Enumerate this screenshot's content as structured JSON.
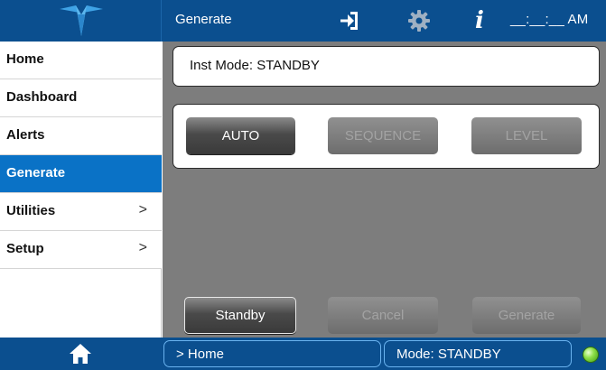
{
  "header": {
    "page_title": "Generate",
    "clock": "__:__:__ AM"
  },
  "sidebar": {
    "items": [
      {
        "label": "Home",
        "has_submenu": false,
        "active": false
      },
      {
        "label": "Dashboard",
        "has_submenu": false,
        "active": false
      },
      {
        "label": "Alerts",
        "has_submenu": false,
        "active": false
      },
      {
        "label": "Generate",
        "has_submenu": false,
        "active": true
      },
      {
        "label": "Utilities",
        "has_submenu": true,
        "active": false
      },
      {
        "label": "Setup",
        "has_submenu": true,
        "active": false
      }
    ],
    "chevron": ">"
  },
  "main": {
    "inst_mode": "Inst Mode:  STANDBY",
    "mode_buttons": {
      "auto": "AUTO",
      "sequence": "SEQUENCE",
      "level": "LEVEL"
    },
    "action_buttons": {
      "standby": "Standby",
      "cancel": "Cancel",
      "generate": "Generate"
    }
  },
  "status_bar": {
    "breadcrumb": "> Home",
    "mode": "Mode: STANDBY",
    "status_led_color": "#6cc92c"
  },
  "icons": {
    "logo": "teledyne-logo-icon",
    "login": "login-icon",
    "settings": "gear-icon",
    "info": "info-icon",
    "home": "home-icon"
  },
  "colors": {
    "top_bar": "#0b4f8f",
    "active_nav": "#0a72c6",
    "main_bg": "#7d7d7d"
  }
}
